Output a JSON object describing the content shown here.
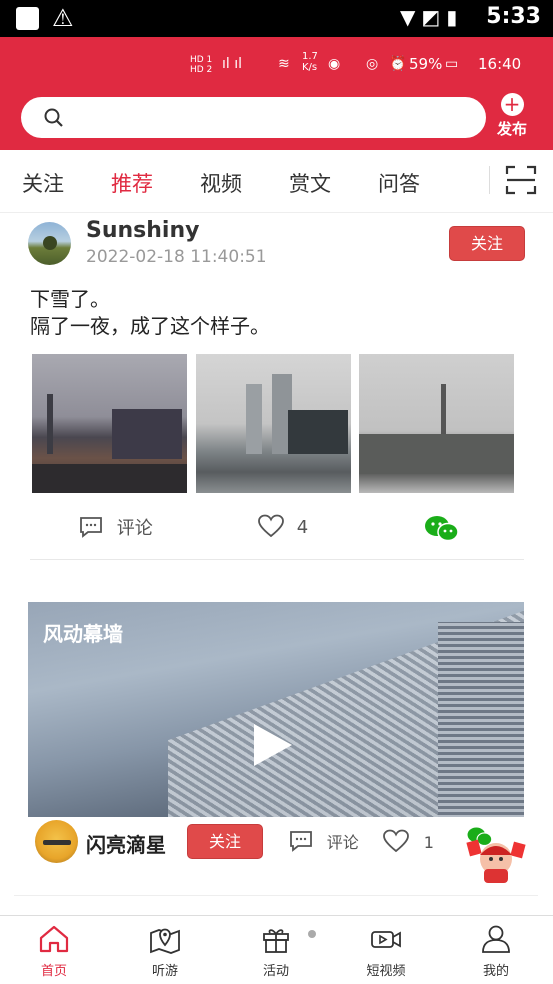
{
  "system_status": {
    "time": "5:33"
  },
  "app_status": {
    "network_speed": "1.7\nK/s",
    "battery": "59%",
    "time": "16:40"
  },
  "search": {
    "placeholder": ""
  },
  "header": {
    "publish_label": "发布"
  },
  "tabs": [
    {
      "label": "关注",
      "active": false
    },
    {
      "label": "推荐",
      "active": true
    },
    {
      "label": "视频",
      "active": false
    },
    {
      "label": "赏文",
      "active": false
    },
    {
      "label": "问答",
      "active": false
    }
  ],
  "post1": {
    "author": "Sunshiny",
    "time": "2022-02-18 11:40:51",
    "follow_label": "关注",
    "text_line1": "下雪了。",
    "text_line2": "隔了一夜，成了这个样子。",
    "comment_label": "评论",
    "like_count": "4"
  },
  "post2": {
    "video_title": "风动幕墙",
    "author": "闪亮滴星",
    "follow_label": "关注",
    "comment_label": "评论",
    "like_count": "1"
  },
  "bottom_nav": [
    {
      "label": "首页",
      "icon": "home-icon",
      "active": true
    },
    {
      "label": "听游",
      "icon": "map-pin-icon",
      "active": false
    },
    {
      "label": "活动",
      "icon": "gift-icon",
      "active": false
    },
    {
      "label": "短视频",
      "icon": "video-icon",
      "active": false
    },
    {
      "label": "我的",
      "icon": "profile-icon",
      "active": false
    }
  ],
  "colors": {
    "brand_red": "#e02a41",
    "wechat_green": "#1aad19"
  }
}
